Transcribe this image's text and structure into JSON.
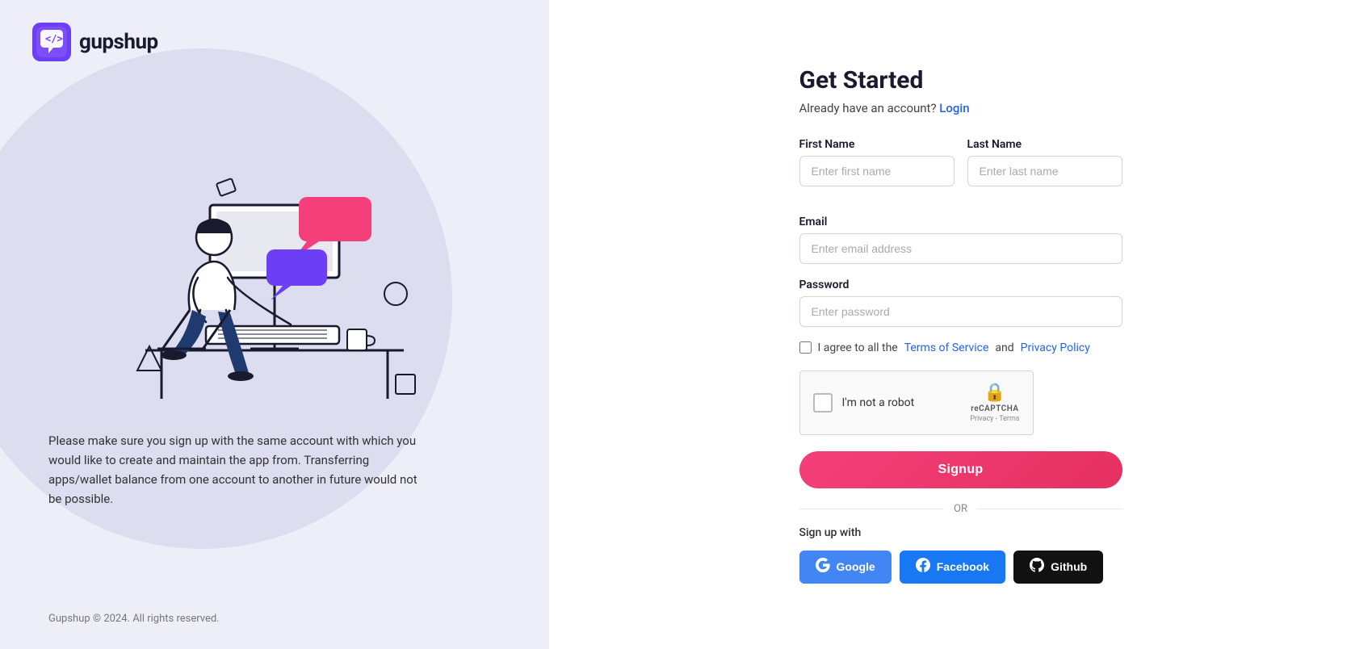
{
  "logo": {
    "text": "gupshup"
  },
  "left": {
    "description": "Please make sure you sign up with the same account with which you would like to create and maintain the app from. Transferring apps/wallet balance from one account to another in future would not be possible.",
    "footer": "Gupshup © 2024. All rights reserved."
  },
  "form": {
    "title": "Get Started",
    "subtitle": "Already have an account?",
    "login_link": "Login",
    "first_name_label": "First Name",
    "first_name_placeholder": "Enter first name",
    "last_name_label": "Last Name",
    "last_name_placeholder": "Enter last name",
    "email_label": "Email",
    "email_placeholder": "Enter email address",
    "password_label": "Password",
    "password_placeholder": "Enter password",
    "terms_prefix": "I agree to all the ",
    "terms_link": "Terms of Service",
    "terms_and": "and",
    "privacy_link": "Privacy Policy",
    "recaptcha_label": "I'm not a robot",
    "recaptcha_brand": "reCAPTCHA",
    "recaptcha_links": "Privacy - Terms",
    "signup_button": "Signup",
    "or_text": "OR",
    "sign_up_with": "Sign up with",
    "google_label": "Google",
    "facebook_label": "Facebook",
    "github_label": "Github"
  }
}
